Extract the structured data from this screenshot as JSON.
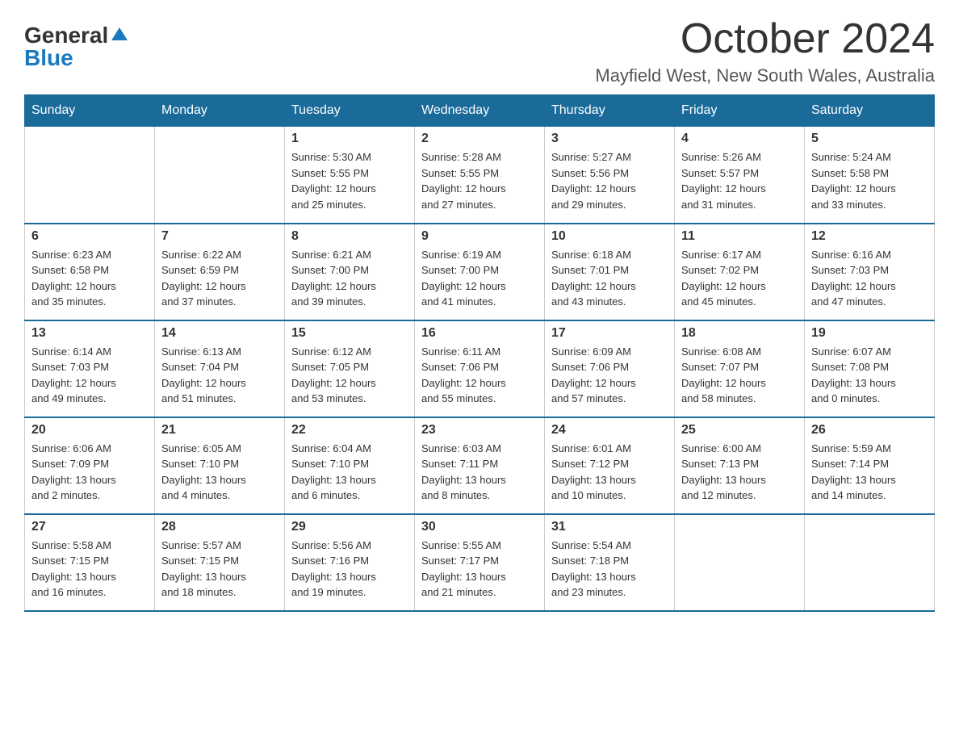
{
  "logo": {
    "general": "General",
    "blue": "Blue"
  },
  "title": "October 2024",
  "location": "Mayfield West, New South Wales, Australia",
  "days_of_week": [
    "Sunday",
    "Monday",
    "Tuesday",
    "Wednesday",
    "Thursday",
    "Friday",
    "Saturday"
  ],
  "weeks": [
    [
      {
        "day": "",
        "info": ""
      },
      {
        "day": "",
        "info": ""
      },
      {
        "day": "1",
        "info": "Sunrise: 5:30 AM\nSunset: 5:55 PM\nDaylight: 12 hours\nand 25 minutes."
      },
      {
        "day": "2",
        "info": "Sunrise: 5:28 AM\nSunset: 5:55 PM\nDaylight: 12 hours\nand 27 minutes."
      },
      {
        "day": "3",
        "info": "Sunrise: 5:27 AM\nSunset: 5:56 PM\nDaylight: 12 hours\nand 29 minutes."
      },
      {
        "day": "4",
        "info": "Sunrise: 5:26 AM\nSunset: 5:57 PM\nDaylight: 12 hours\nand 31 minutes."
      },
      {
        "day": "5",
        "info": "Sunrise: 5:24 AM\nSunset: 5:58 PM\nDaylight: 12 hours\nand 33 minutes."
      }
    ],
    [
      {
        "day": "6",
        "info": "Sunrise: 6:23 AM\nSunset: 6:58 PM\nDaylight: 12 hours\nand 35 minutes."
      },
      {
        "day": "7",
        "info": "Sunrise: 6:22 AM\nSunset: 6:59 PM\nDaylight: 12 hours\nand 37 minutes."
      },
      {
        "day": "8",
        "info": "Sunrise: 6:21 AM\nSunset: 7:00 PM\nDaylight: 12 hours\nand 39 minutes."
      },
      {
        "day": "9",
        "info": "Sunrise: 6:19 AM\nSunset: 7:00 PM\nDaylight: 12 hours\nand 41 minutes."
      },
      {
        "day": "10",
        "info": "Sunrise: 6:18 AM\nSunset: 7:01 PM\nDaylight: 12 hours\nand 43 minutes."
      },
      {
        "day": "11",
        "info": "Sunrise: 6:17 AM\nSunset: 7:02 PM\nDaylight: 12 hours\nand 45 minutes."
      },
      {
        "day": "12",
        "info": "Sunrise: 6:16 AM\nSunset: 7:03 PM\nDaylight: 12 hours\nand 47 minutes."
      }
    ],
    [
      {
        "day": "13",
        "info": "Sunrise: 6:14 AM\nSunset: 7:03 PM\nDaylight: 12 hours\nand 49 minutes."
      },
      {
        "day": "14",
        "info": "Sunrise: 6:13 AM\nSunset: 7:04 PM\nDaylight: 12 hours\nand 51 minutes."
      },
      {
        "day": "15",
        "info": "Sunrise: 6:12 AM\nSunset: 7:05 PM\nDaylight: 12 hours\nand 53 minutes."
      },
      {
        "day": "16",
        "info": "Sunrise: 6:11 AM\nSunset: 7:06 PM\nDaylight: 12 hours\nand 55 minutes."
      },
      {
        "day": "17",
        "info": "Sunrise: 6:09 AM\nSunset: 7:06 PM\nDaylight: 12 hours\nand 57 minutes."
      },
      {
        "day": "18",
        "info": "Sunrise: 6:08 AM\nSunset: 7:07 PM\nDaylight: 12 hours\nand 58 minutes."
      },
      {
        "day": "19",
        "info": "Sunrise: 6:07 AM\nSunset: 7:08 PM\nDaylight: 13 hours\nand 0 minutes."
      }
    ],
    [
      {
        "day": "20",
        "info": "Sunrise: 6:06 AM\nSunset: 7:09 PM\nDaylight: 13 hours\nand 2 minutes."
      },
      {
        "day": "21",
        "info": "Sunrise: 6:05 AM\nSunset: 7:10 PM\nDaylight: 13 hours\nand 4 minutes."
      },
      {
        "day": "22",
        "info": "Sunrise: 6:04 AM\nSunset: 7:10 PM\nDaylight: 13 hours\nand 6 minutes."
      },
      {
        "day": "23",
        "info": "Sunrise: 6:03 AM\nSunset: 7:11 PM\nDaylight: 13 hours\nand 8 minutes."
      },
      {
        "day": "24",
        "info": "Sunrise: 6:01 AM\nSunset: 7:12 PM\nDaylight: 13 hours\nand 10 minutes."
      },
      {
        "day": "25",
        "info": "Sunrise: 6:00 AM\nSunset: 7:13 PM\nDaylight: 13 hours\nand 12 minutes."
      },
      {
        "day": "26",
        "info": "Sunrise: 5:59 AM\nSunset: 7:14 PM\nDaylight: 13 hours\nand 14 minutes."
      }
    ],
    [
      {
        "day": "27",
        "info": "Sunrise: 5:58 AM\nSunset: 7:15 PM\nDaylight: 13 hours\nand 16 minutes."
      },
      {
        "day": "28",
        "info": "Sunrise: 5:57 AM\nSunset: 7:15 PM\nDaylight: 13 hours\nand 18 minutes."
      },
      {
        "day": "29",
        "info": "Sunrise: 5:56 AM\nSunset: 7:16 PM\nDaylight: 13 hours\nand 19 minutes."
      },
      {
        "day": "30",
        "info": "Sunrise: 5:55 AM\nSunset: 7:17 PM\nDaylight: 13 hours\nand 21 minutes."
      },
      {
        "day": "31",
        "info": "Sunrise: 5:54 AM\nSunset: 7:18 PM\nDaylight: 13 hours\nand 23 minutes."
      },
      {
        "day": "",
        "info": ""
      },
      {
        "day": "",
        "info": ""
      }
    ]
  ]
}
